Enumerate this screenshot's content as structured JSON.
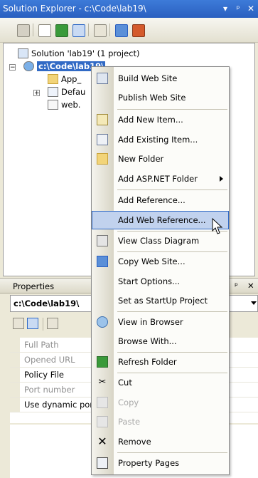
{
  "solution_explorer": {
    "title": "Solution Explorer - c:\\Code\\lab19\\",
    "title_buttons": [
      "▾",
      "ᵖ",
      "✕"
    ],
    "tree": {
      "solution_label": "Solution 'lab19' (1 project)",
      "project_label": "c:\\Code\\lab19\\",
      "children": [
        "App_",
        "Defau",
        "web."
      ]
    }
  },
  "properties": {
    "title": "Properties",
    "title_buttons": [
      "ᵖ",
      "✕"
    ],
    "object_name": "c:\\Code\\lab19\\",
    "rows": [
      {
        "name": "Full Path",
        "dim": true
      },
      {
        "name": "Opened URL",
        "dim": true
      },
      {
        "name": "Policy File",
        "dim": false
      },
      {
        "name": "Port number",
        "dim": true
      },
      {
        "name": "Use dynamic por",
        "dim": false
      }
    ]
  },
  "context_menu": {
    "items": [
      {
        "label": "Build Web Site",
        "icon": "build-icon"
      },
      {
        "label": "Publish Web Site",
        "icon": ""
      },
      {
        "label": "Add New Item...",
        "icon": "new-item-icon"
      },
      {
        "label": "Add Existing Item...",
        "icon": "existing-item-icon"
      },
      {
        "label": "New Folder",
        "icon": "folder-icon"
      },
      {
        "label": "Add ASP.NET Folder",
        "icon": "",
        "submenu": true
      },
      {
        "label": "Add Reference...",
        "icon": ""
      },
      {
        "label": "Add Web Reference...",
        "icon": "",
        "highlighted": true
      },
      {
        "label": "View Class Diagram",
        "icon": "class-diagram-icon"
      },
      {
        "label": "Copy Web Site...",
        "icon": "copy-web-site-icon"
      },
      {
        "label": "Start Options...",
        "icon": ""
      },
      {
        "label": "Set as StartUp Project",
        "icon": ""
      },
      {
        "label": "View in Browser",
        "icon": "browser-icon"
      },
      {
        "label": "Browse With...",
        "icon": ""
      },
      {
        "label": "Refresh Folder",
        "icon": "refresh-icon"
      },
      {
        "label": "Cut",
        "icon": "cut-icon"
      },
      {
        "label": "Copy",
        "icon": "copy-icon",
        "disabled": true
      },
      {
        "label": "Paste",
        "icon": "paste-icon",
        "disabled": true
      },
      {
        "label": "Remove",
        "icon": "remove-icon"
      },
      {
        "label": "Property Pages",
        "icon": "property-pages-icon"
      }
    ]
  },
  "colors": {
    "title_bar": "#2a5fc0",
    "selection": "#316ac5",
    "menu_highlight": "#c1d2ee"
  }
}
